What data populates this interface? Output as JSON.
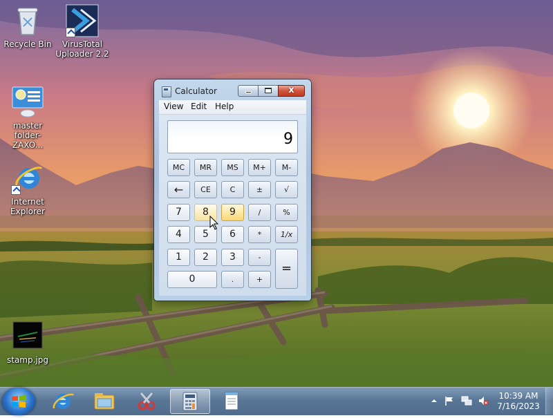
{
  "desktop": {
    "icons": [
      {
        "label": "Recycle Bin"
      },
      {
        "label_line1": "VirusTotal",
        "label_line2": "Uploader 2.2"
      },
      {
        "label_line1": "master",
        "label_line2": "folder-ZAXO..."
      },
      {
        "label_line1": "Internet",
        "label_line2": "Explorer"
      },
      {
        "label": "stamp.jpg"
      }
    ]
  },
  "calculator": {
    "title": "Calculator",
    "menu": [
      "View",
      "Edit",
      "Help"
    ],
    "display_value": "9",
    "memory_keys": [
      "MC",
      "MR",
      "MS",
      "M+",
      "M-"
    ],
    "row2": [
      "←",
      "CE",
      "C",
      "±",
      "√"
    ],
    "row3": [
      "7",
      "8",
      "9",
      "/",
      "%"
    ],
    "row4": [
      "4",
      "5",
      "6",
      "*",
      "1/x"
    ],
    "row5": [
      "1",
      "2",
      "3",
      "-",
      "="
    ],
    "row6": [
      "0",
      ".",
      "+"
    ],
    "close_glyph": "x"
  },
  "taskbar": {
    "clock_time": "10:39 AM",
    "clock_date": "7/16/2023",
    "pinned": [
      "ie-icon",
      "explorer-folder-icon",
      "snipping-tool-icon",
      "calculator-icon",
      "notepad-icon"
    ]
  },
  "colors": {
    "taskbar": "#4f6f93",
    "hover_key": "#fde9a8",
    "window_frame": "#b2c9e2"
  }
}
